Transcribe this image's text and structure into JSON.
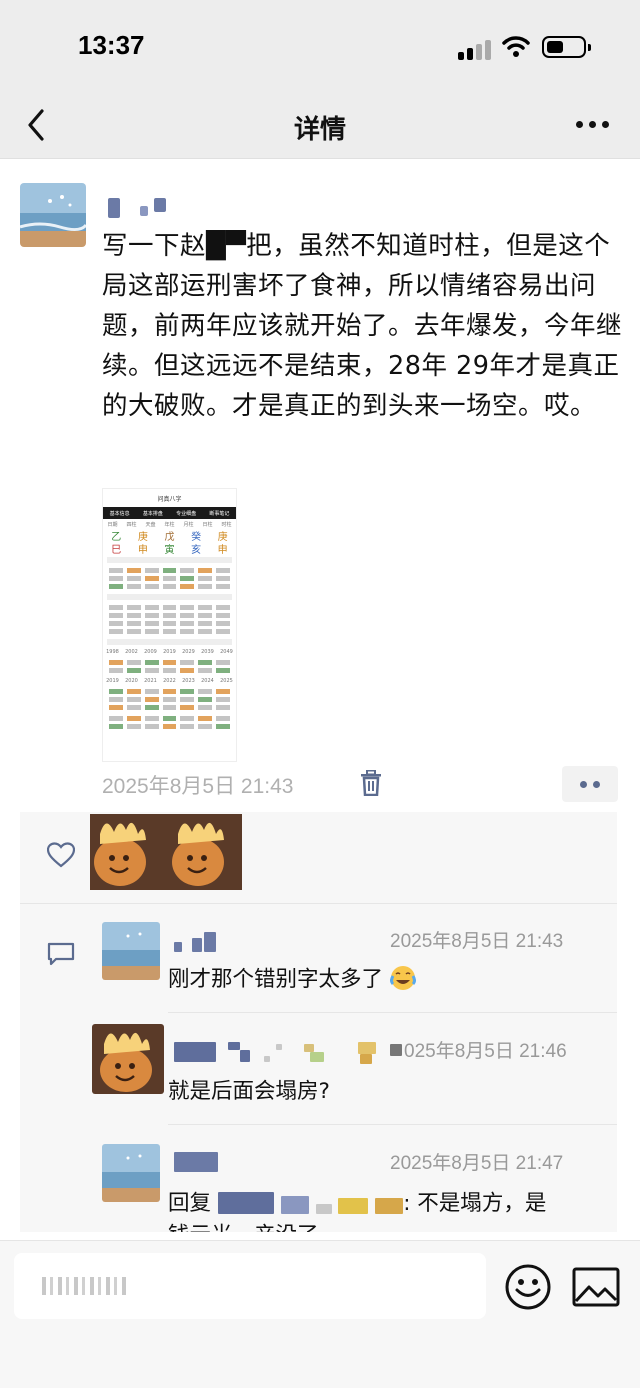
{
  "status_bar": {
    "time": "13:37"
  },
  "nav": {
    "title": "详情"
  },
  "post": {
    "text": "写一下赵█▀把，虽然不知道时柱，但是这个局这部运刑害坏了食神，所以情绪容易出问题，前两年应该就开始了。去年爆发，今年继续。但这远远不是结束，28年 29年才是真正的大破败。才是真正的到头来一场空。哎。",
    "image": {
      "title": "问真八字",
      "tabs": [
        "基本信息",
        "基本排盘",
        "专业细盘",
        "断事笔记"
      ],
      "header_row": [
        "日期",
        "四柱",
        "天盘",
        "年柱",
        "月柱",
        "日柱",
        "时柱"
      ],
      "big_row": [
        "乙",
        "庚",
        "戊",
        "癸",
        "庚"
      ],
      "big_row2": [
        "巳",
        "申",
        "寅",
        "亥",
        "申"
      ],
      "year_row": [
        "1998",
        "2002",
        "2009",
        "2019",
        "2029",
        "2039",
        "2049"
      ],
      "year_row2": [
        "2019",
        "2020",
        "2021",
        "2022",
        "2023",
        "2024",
        "2025"
      ]
    },
    "timestamp": "2025年8月5日 21:43"
  },
  "comments": [
    {
      "time": "2025年8月5日 21:43",
      "text": "刚才那个错别字太多了"
    },
    {
      "time": "2025年8月5日 21:46",
      "time_visible": "025年8月5日 21:46",
      "text": "就是后面会塌房?"
    },
    {
      "time": "2025年8月5日 21:47",
      "time_visible": "2025年8月5日 21:47",
      "text_prefix": "回复",
      "text_suffix": ": 不是塌方，是",
      "text_line2": "钱云光，产没了"
    }
  ],
  "colors": {
    "bg_nav": "#ededed",
    "comment_bg": "#f7f7f7",
    "meta_gray": "#b0b0b0",
    "link_blue": "#5b6b8f"
  },
  "icons": [
    "back-icon",
    "more-icon",
    "trash-icon",
    "heart-icon",
    "comment-icon",
    "emoji-icon",
    "image-icon"
  ]
}
